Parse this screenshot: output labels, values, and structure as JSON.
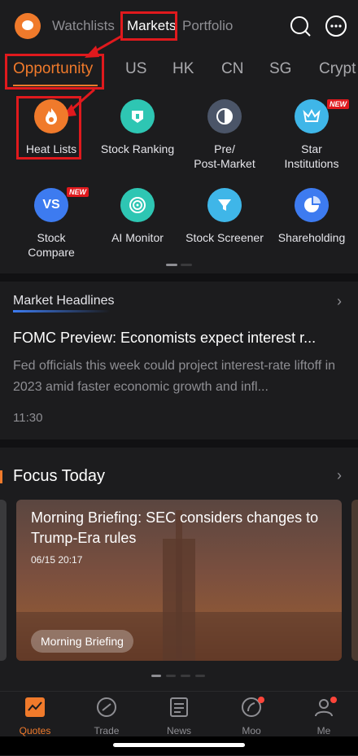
{
  "top_nav": {
    "tabs": [
      "Watchlists",
      "Markets",
      "Portfolio"
    ],
    "active": "Markets",
    "icons": [
      "search-icon",
      "chat-icon"
    ]
  },
  "category_tabs": {
    "items": [
      "Opportunity",
      "US",
      "HK",
      "CN",
      "SG",
      "Crypt"
    ],
    "active": "Opportunity"
  },
  "tools": [
    {
      "label": "Heat Lists",
      "icon": "flame-icon",
      "color": "#f07a2b"
    },
    {
      "label": "Stock Ranking",
      "icon": "ranking-icon",
      "color": "#2ec6b3"
    },
    {
      "label": "Pre/\nPost-Market",
      "icon": "half-circle-icon",
      "color": "#4b5568"
    },
    {
      "label": "Star\nInstitutions",
      "icon": "crown-icon",
      "color": "#3fb6e8",
      "badge": "NEW"
    },
    {
      "label": "Stock\nCompare",
      "icon": "vs-icon",
      "color": "#3d7bf0",
      "badge": "NEW"
    },
    {
      "label": "AI Monitor",
      "icon": "ai-target-icon",
      "color": "#2ec6b3"
    },
    {
      "label": "Stock Screener",
      "icon": "filter-icon",
      "color": "#3fb6e8"
    },
    {
      "label": "Shareholding",
      "icon": "shareholding-icon",
      "color": "#3d7bf0"
    }
  ],
  "headlines": {
    "section_title": "Market Headlines",
    "title": "FOMC Preview: Economists expect interest r...",
    "summary": "Fed officials this week could project interest-rate liftoff in 2023 amid faster economic growth and infl...",
    "time": "11:30"
  },
  "focus": {
    "section_title": "Focus Today",
    "card_title": "Morning Briefing: SEC considers changes to Trump-Era rules",
    "card_date": "06/15 20:17",
    "card_tag": "Morning Briefing"
  },
  "bottom_nav": [
    {
      "label": "Quotes",
      "icon": "quotes-icon",
      "active": true
    },
    {
      "label": "Trade",
      "icon": "trade-icon"
    },
    {
      "label": "News",
      "icon": "news-icon"
    },
    {
      "label": "Moo",
      "icon": "moo-icon",
      "dot": true
    },
    {
      "label": "Me",
      "icon": "profile-icon",
      "dot": true
    }
  ],
  "colors": {
    "accent": "#f07a2b",
    "highlight": "#e0191d",
    "background": "#1c1c1e"
  }
}
